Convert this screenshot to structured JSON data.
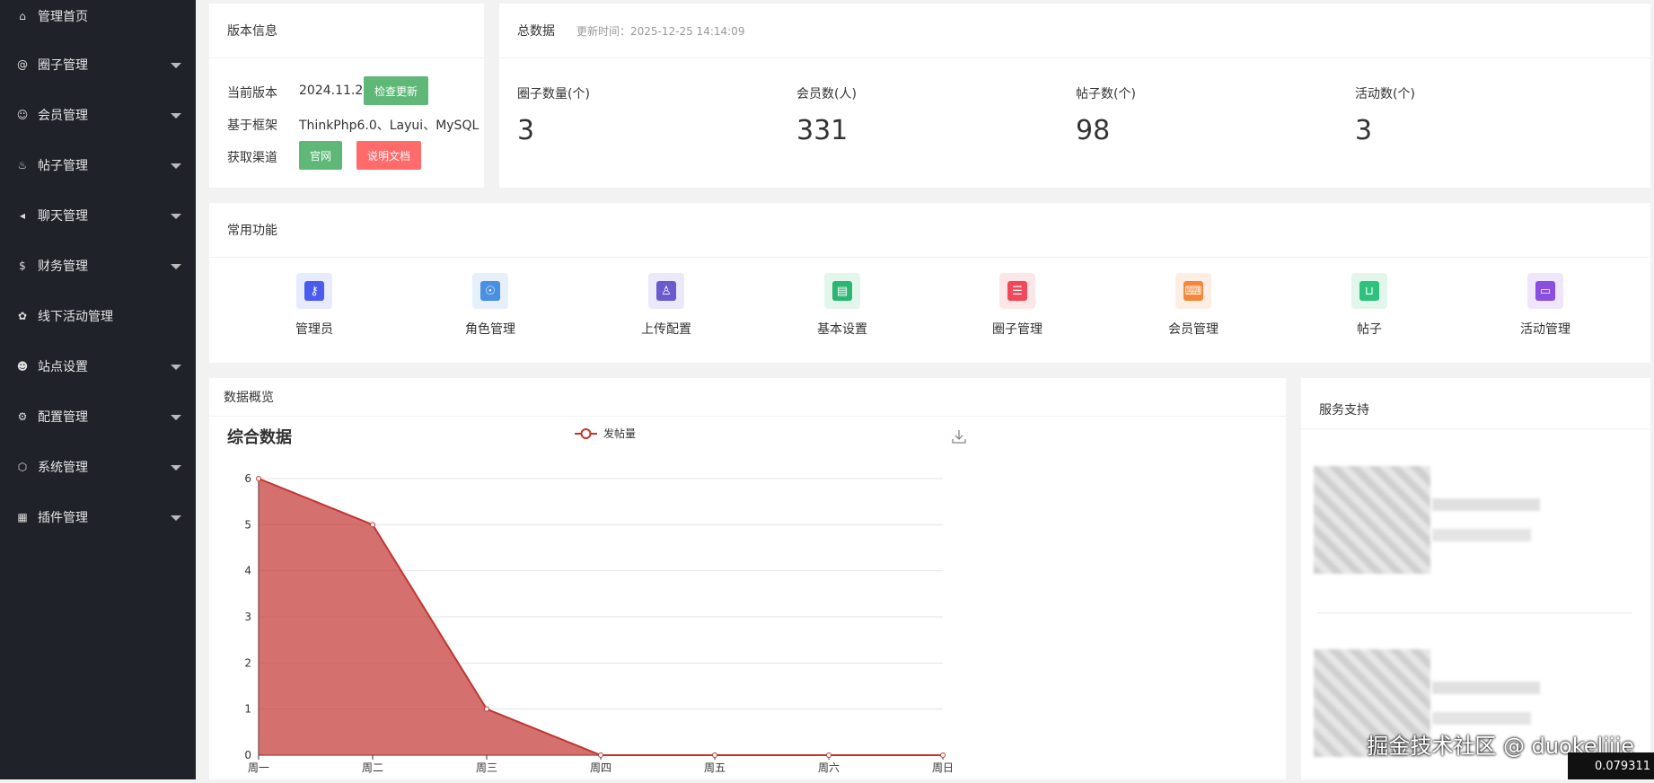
{
  "sidebar": {
    "items": [
      {
        "label": "管理首页",
        "icon": "home-icon",
        "glyph": "⌂"
      },
      {
        "label": "圈子管理",
        "icon": "at-icon",
        "glyph": "@",
        "caret": true
      },
      {
        "label": "会员管理",
        "icon": "user-icon",
        "glyph": "☺",
        "caret": true
      },
      {
        "label": "帖子管理",
        "icon": "fire-icon",
        "glyph": "♨",
        "caret": true
      },
      {
        "label": "聊天管理",
        "icon": "speaker-icon",
        "glyph": "◂",
        "caret": true
      },
      {
        "label": "财务管理",
        "icon": "dollar-icon",
        "glyph": "$",
        "caret": true
      },
      {
        "label": "线下活动管理",
        "icon": "leaf-icon",
        "glyph": "✿"
      },
      {
        "label": "站点设置",
        "icon": "panda-icon",
        "glyph": "☻",
        "caret": true
      },
      {
        "label": "配置管理",
        "icon": "gear-icon",
        "glyph": "⚙",
        "caret": true
      },
      {
        "label": "系统管理",
        "icon": "cube-icon",
        "glyph": "⬡",
        "caret": true
      },
      {
        "label": "插件管理",
        "icon": "windows-icon",
        "glyph": "▦",
        "caret": true
      }
    ]
  },
  "version": {
    "title": "版本信息",
    "current_label": "当前版本",
    "current_value": "2024.11.24",
    "check_update": "检查更新",
    "framework_label": "基于框架",
    "framework_value": "ThinkPhp6.0、Layui、MySQL",
    "channel_label": "获取渠道",
    "official": "官网",
    "docs": "说明文档"
  },
  "totals": {
    "title": "总数据",
    "updated": "更新时间：2025-12-25 14:14:09",
    "stats": [
      {
        "label": "圈子数量(个)",
        "value": "3"
      },
      {
        "label": "会员数(人)",
        "value": "331"
      },
      {
        "label": "帖子数(个)",
        "value": "98"
      },
      {
        "label": "活动数(个)",
        "value": "3"
      }
    ]
  },
  "functions": {
    "title": "常用功能",
    "items": [
      {
        "label": "管理员",
        "icon": "admin-icon",
        "color": "#4a5cf0",
        "bg": "#e8eafd"
      },
      {
        "label": "角色管理",
        "icon": "role-icon",
        "color": "#4a90e2",
        "bg": "#e6f0fb"
      },
      {
        "label": "上传配置",
        "icon": "upload-icon",
        "color": "#6a5acd",
        "bg": "#ebe8f9"
      },
      {
        "label": "基本设置",
        "icon": "book-icon",
        "color": "#2bb673",
        "bg": "#e3f6ec"
      },
      {
        "label": "圈子管理",
        "icon": "server-icon",
        "color": "#f04a5a",
        "bg": "#fde6e8"
      },
      {
        "label": "会员管理",
        "icon": "code-window-icon",
        "color": "#f5873b",
        "bg": "#fdeee3"
      },
      {
        "label": "帖子",
        "icon": "bag-icon",
        "color": "#2ec27e",
        "bg": "#e2f6ec"
      },
      {
        "label": "活动管理",
        "icon": "card-icon",
        "color": "#8a4fe0",
        "bg": "#efe6fb"
      }
    ]
  },
  "overview": {
    "title": "数据概览",
    "download_icon": "download-icon"
  },
  "service": {
    "title": "服务支持"
  },
  "chart_data": {
    "type": "area",
    "title": "综合数据",
    "categories": [
      "周一",
      "周二",
      "周三",
      "周四",
      "周五",
      "周六",
      "周日"
    ],
    "series": [
      {
        "name": "发帖量",
        "values": [
          6,
          5,
          1,
          0,
          0,
          0,
          0
        ]
      }
    ],
    "ylim": [
      0,
      6
    ],
    "yticks": [
      "0",
      "1",
      "2",
      "3",
      "4",
      "5",
      "6"
    ],
    "color": "#c23531",
    "grid": true,
    "legend": "top-center"
  },
  "watermark": "掘金技术社区 @ duokelijie",
  "fps": "0.079311"
}
